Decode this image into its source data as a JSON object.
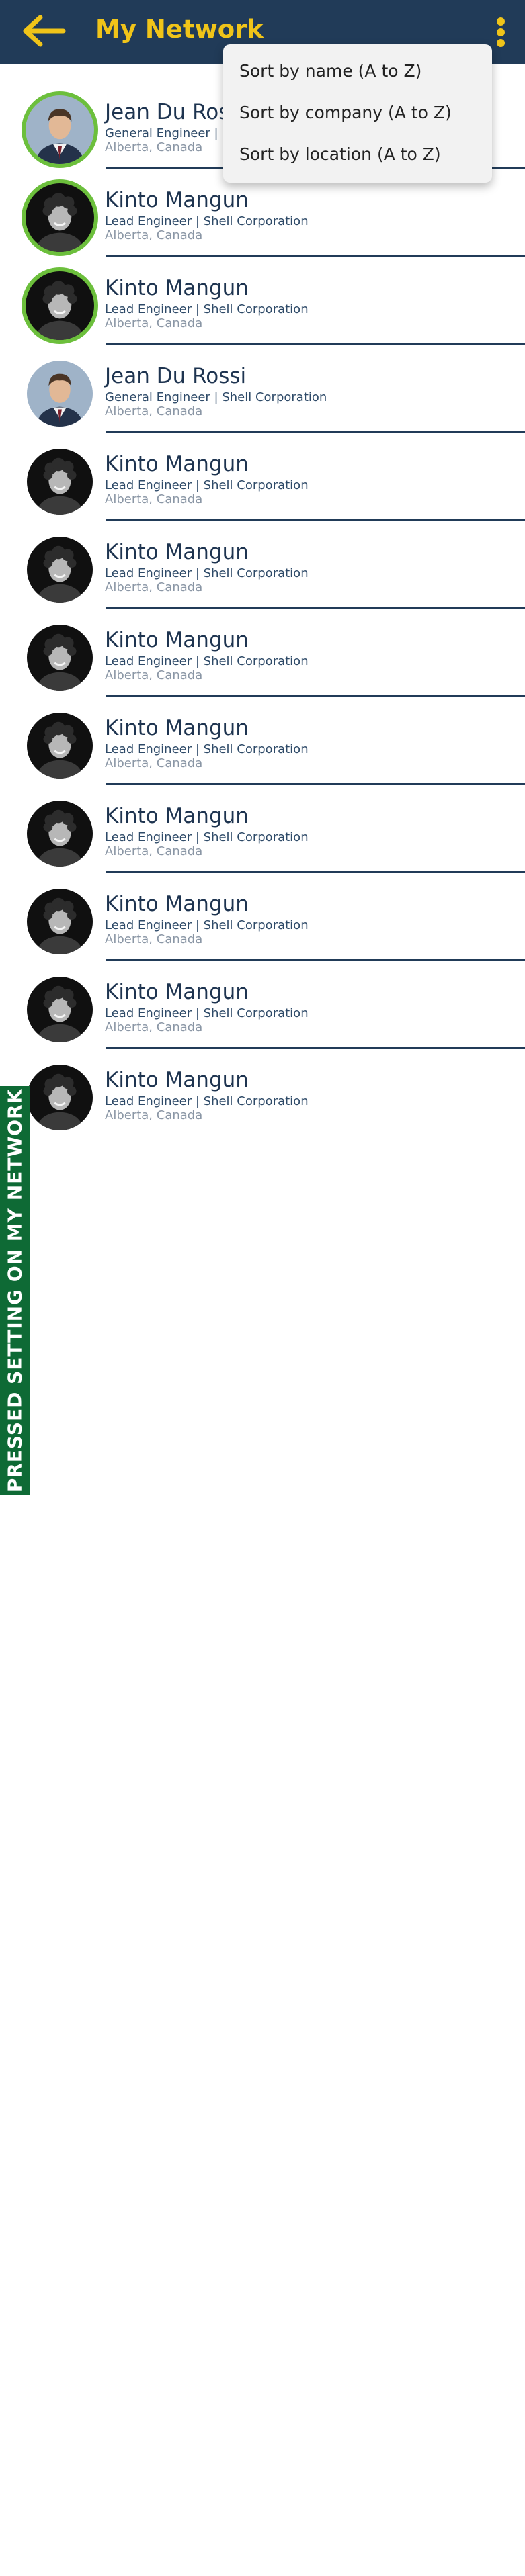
{
  "header": {
    "title": "My Network",
    "background": "#213b58",
    "accent": "#f0c419",
    "back_icon": "arrow-left-icon",
    "menu_icon": "kebab-menu-icon"
  },
  "sort_menu": {
    "items": [
      {
        "label": "Sort by name (A to Z)"
      },
      {
        "label": "Sort by company (A to Z)"
      },
      {
        "label": "Sort by location (A to Z)"
      }
    ]
  },
  "contacts": [
    {
      "name": "Jean Du Rossi",
      "title": "General Engineer | Shell Corporation",
      "location": "Alberta, Canada",
      "avatar": "man-in-suit-avatar",
      "highlighted": true
    },
    {
      "name": "Kinto Mangun",
      "title": "Lead Engineer | Shell Corporation",
      "location": "Alberta, Canada",
      "avatar": "man-curly-hair-avatar",
      "highlighted": true
    },
    {
      "name": "Kinto Mangun",
      "title": "Lead Engineer | Shell Corporation",
      "location": "Alberta, Canada",
      "avatar": "man-curly-hair-avatar",
      "highlighted": true
    },
    {
      "name": "Jean Du Rossi",
      "title": "General Engineer | Shell Corporation",
      "location": "Alberta, Canada",
      "avatar": "man-in-suit-avatar",
      "highlighted": false
    },
    {
      "name": "Kinto Mangun",
      "title": "Lead Engineer | Shell Corporation",
      "location": "Alberta, Canada",
      "avatar": "man-curly-hair-avatar",
      "highlighted": false
    },
    {
      "name": "Kinto Mangun",
      "title": "Lead Engineer | Shell Corporation",
      "location": "Alberta, Canada",
      "avatar": "man-curly-hair-avatar",
      "highlighted": false
    },
    {
      "name": "Kinto Mangun",
      "title": "Lead Engineer | Shell Corporation",
      "location": "Alberta, Canada",
      "avatar": "man-curly-hair-avatar",
      "highlighted": false
    },
    {
      "name": "Kinto Mangun",
      "title": "Lead Engineer | Shell Corporation",
      "location": "Alberta, Canada",
      "avatar": "man-curly-hair-avatar",
      "highlighted": false
    },
    {
      "name": "Kinto Mangun",
      "title": "Lead Engineer | Shell Corporation",
      "location": "Alberta, Canada",
      "avatar": "man-curly-hair-avatar",
      "highlighted": false
    },
    {
      "name": "Kinto Mangun",
      "title": "Lead Engineer | Shell Corporation",
      "location": "Alberta, Canada",
      "avatar": "man-curly-hair-avatar",
      "highlighted": false
    },
    {
      "name": "Kinto Mangun",
      "title": "Lead Engineer | Shell Corporation",
      "location": "Alberta, Canada",
      "avatar": "man-curly-hair-avatar",
      "highlighted": false
    },
    {
      "name": "Kinto Mangun",
      "title": "Lead Engineer | Shell Corporation",
      "location": "Alberta, Canada",
      "avatar": "man-curly-hair-avatar",
      "highlighted": false
    }
  ],
  "annotation": {
    "text": "PRESSED SETTING ON MY NETWORK",
    "color": "#0e6a35"
  }
}
